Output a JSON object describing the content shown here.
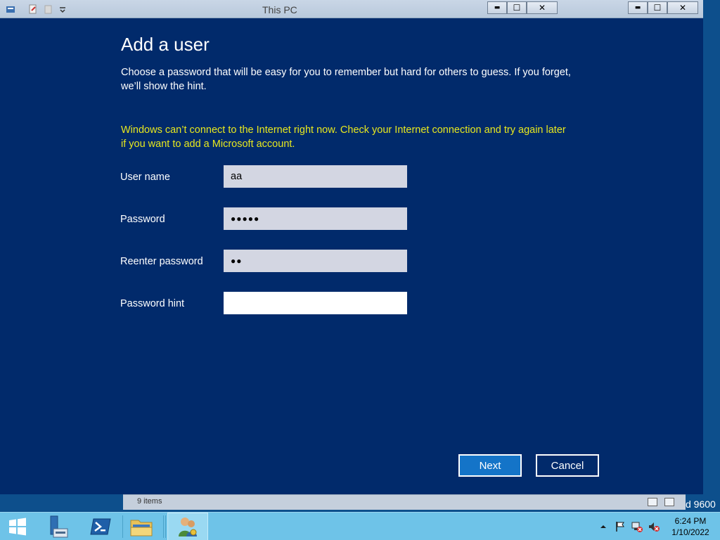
{
  "background_window": {
    "title": "This PC",
    "controls": {
      "minimize": "▬",
      "maximize": "☐",
      "close": "✕"
    },
    "status": {
      "items_count": "9 items",
      "build_suffix": "d 9600"
    }
  },
  "dialog": {
    "title": "Add a user",
    "description": "Choose a password that will be easy for you to remember but hard for others to guess. If you forget, we’ll show the hint.",
    "warning": "Windows can’t connect to the Internet right now. Check your Internet connection and try again later if you want to add a Microsoft account.",
    "fields": {
      "username": {
        "label": "User name",
        "value": "aa"
      },
      "password": {
        "label": "Password",
        "value": "●●●●●"
      },
      "reenter": {
        "label": "Reenter password",
        "value": "●●"
      },
      "hint": {
        "label": "Password hint",
        "value": ""
      }
    },
    "buttons": {
      "next": "Next",
      "cancel": "Cancel"
    }
  },
  "taskbar": {
    "clock": {
      "time": "6:24 PM",
      "date": "1/10/2022"
    },
    "apps": [
      "start",
      "server-manager",
      "powershell",
      "file-explorer",
      "user-accounts"
    ]
  },
  "colors": {
    "dialog_bg": "#012a6b",
    "warning": "#e8e81e",
    "accent_button": "#1474c8",
    "taskbar": "#6ec3e8"
  }
}
